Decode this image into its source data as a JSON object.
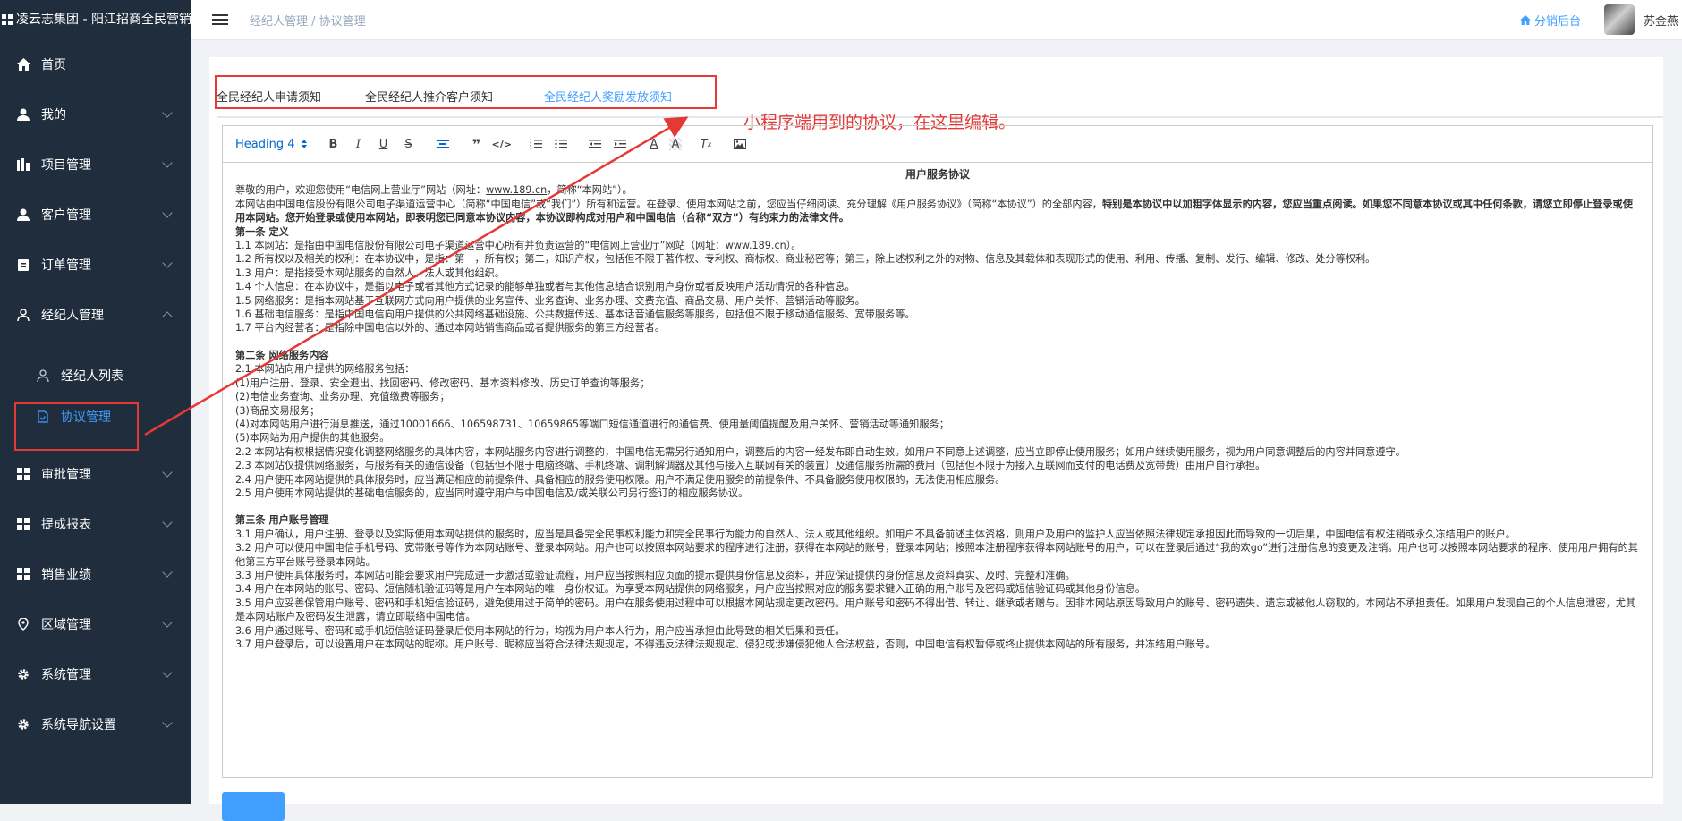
{
  "brand": {
    "title": "凌云志集团 - 阳江招商全民营销"
  },
  "sidebar": {
    "items": [
      {
        "label": "首页",
        "icon": "home-icon",
        "has_children": false
      },
      {
        "label": "我的",
        "icon": "user-icon",
        "has_children": true
      },
      {
        "label": "项目管理",
        "icon": "chart-bars-icon",
        "has_children": true
      },
      {
        "label": "客户管理",
        "icon": "user-icon",
        "has_children": true
      },
      {
        "label": "订单管理",
        "icon": "clipboard-icon",
        "has_children": true
      },
      {
        "label": "经纪人管理",
        "icon": "person-outline-icon",
        "has_children": true,
        "expanded": true,
        "children": [
          {
            "label": "经纪人列表",
            "icon": "person-outline-icon"
          },
          {
            "label": "协议管理",
            "icon": "document-icon",
            "active": true
          }
        ]
      },
      {
        "label": "审批管理",
        "icon": "grid-icon",
        "has_children": true
      },
      {
        "label": "提成报表",
        "icon": "grid-icon",
        "has_children": true
      },
      {
        "label": "销售业绩",
        "icon": "grid-icon",
        "has_children": true
      },
      {
        "label": "区域管理",
        "icon": "location-icon",
        "has_children": true
      },
      {
        "label": "系统管理",
        "icon": "gear-icon",
        "has_children": true
      },
      {
        "label": "系统导航设置",
        "icon": "gear-icon",
        "has_children": true
      }
    ]
  },
  "header": {
    "breadcrumb": [
      "经纪人管理",
      "协议管理"
    ],
    "home_link": "分销后台",
    "username": "苏金燕"
  },
  "tabs": [
    {
      "label": "全民经纪人申请须知"
    },
    {
      "label": "全民经纪人推介客户须知"
    },
    {
      "label": "全民经纪人奖励发放须知",
      "active": true
    }
  ],
  "annotation": {
    "text": "小程序端用到的协议，在这里编辑。",
    "color": "#e53935"
  },
  "editor": {
    "heading_select": "Heading 4",
    "toolbar_icons": [
      "bold-icon",
      "italic-icon",
      "underline-icon",
      "strikethrough-icon",
      "align-icon",
      "blockquote-icon",
      "code-icon",
      "ordered-list-icon",
      "bullet-list-icon",
      "outdent-icon",
      "indent-icon",
      "font-color-icon",
      "background-color-icon",
      "clear-format-icon",
      "image-icon"
    ],
    "content": {
      "title": "用户服务协议",
      "p1a": "尊敬的用户，欢迎您使用“电信网上营业厅”网站（网址：",
      "p1_link": "www.189.cn",
      "p1b": "，简称“本网站”）。",
      "p2a": "本网站由中国电信股份有限公司电子渠道运营中心（简称“中国电信”或“我们”）所有和运营。在登录、使用本网站之前，您应当仔细阅读、充分理解《用户服务协议》（简称“本协议”）的全部内容，",
      "p2b": "特别是本协议中以加粗字体显示的内容，您应当重点阅读。如果您不同意本协议或其中任何条款，请您立即停止登录或使用本网站。您开始登录或使用本网站，即表明您已同意本协议内容，本协议即构成对用户和中国电信（合称“双方”）有约束力的法律文件。",
      "s1": "第一条 定义",
      "s1_1a": "1.1 本网站：是指由中国电信股份有限公司电子渠道运营中心所有并负责运营的“电信网上营业厅”网站（网址：",
      "s1_1_link": "www.189.cn",
      "s1_1b": "）。",
      "s1_2": "1.2 所有权以及相关的权利：在本协议中，是指：第一，所有权；第二，知识产权，包括但不限于著作权、专利权、商标权、商业秘密等；第三，除上述权利之外的对物、信息及其载体和表现形式的使用、利用、传播、复制、发行、编辑、修改、处分等权利。",
      "s1_3": "1.3 用户：是指接受本网站服务的自然人、法人或其他组织。",
      "s1_4": "1.4 个人信息：在本协议中，是指以电子或者其他方式记录的能够单独或者与其他信息结合识别用户身份或者反映用户活动情况的各种信息。",
      "s1_5": "1.5 网络服务：是指本网站基于互联网方式向用户提供的业务宣传、业务查询、业务办理、交费充值、商品交易、用户关怀、营销活动等服务。",
      "s1_6": "1.6 基础电信服务：是指中国电信向用户提供的公共网络基础设施、公共数据传送、基本话音通信服务等服务，包括但不限于移动通信服务、宽带服务等。",
      "s1_7": "1.7 平台内经营者：是指除中国电信以外的、通过本网站销售商品或者提供服务的第三方经营者。",
      "s2": "第二条 网络服务内容",
      "s2_1": "2.1 本网站向用户提供的网络服务包括：",
      "s2_1_1": "(1)用户注册、登录、安全退出、找回密码、修改密码、基本资料修改、历史订单查询等服务；",
      "s2_1_2": "(2)电信业务查询、业务办理、充值缴费等服务；",
      "s2_1_3": "(3)商品交易服务；",
      "s2_1_4": "(4)对本网站用户进行消息推送，通过10001666、106598731、10659865等端口短信通道进行的通信费、使用量阈值提醒及用户关怀、营销活动等通知服务；",
      "s2_1_5": "(5)本网站为用户提供的其他服务。",
      "s2_2": "2.2 本网站有权根据情况变化调整网络服务的具体内容，本网站服务内容进行调整的，中国电信无需另行通知用户，调整后的内容一经发布即自动生效。如用户不同意上述调整，应当立即停止使用服务；如用户继续使用服务，视为用户同意调整后的内容并同意遵守。",
      "s2_3": "2.3 本网站仅提供网络服务，与服务有关的通信设备（包括但不限于电脑终端、手机终端、调制解调器及其他与接入互联网有关的装置）及通信服务所需的费用（包括但不限于为接入互联网而支付的电话费及宽带费）由用户自行承担。",
      "s2_4": "2.4 用户使用本网站提供的具体服务时，应当满足相应的前提条件、具备相应的服务使用权限。用户不满足使用服务的前提条件、不具备服务使用权限的，无法使用相应服务。",
      "s2_5": "2.5 用户使用本网站提供的基础电信服务的，应当同时遵守用户与中国电信及/或关联公司另行签订的相应服务协议。",
      "s3": "第三条 用户账号管理",
      "s3_1": "3.1 用户确认，用户注册、登录以及实际使用本网站提供的服务时，应当是具备完全民事权利能力和完全民事行为能力的自然人、法人或其他组织。如用户不具备前述主体资格，则用户及用户的监护人应当依照法律规定承担因此而导致的一切后果，中国电信有权注销或永久冻结用户的账户。",
      "s3_2": "3.2 用户可以使用中国电信手机号码、宽带账号等作为本网站账号、登录本网站。用户也可以按照本网站要求的程序进行注册，获得在本网站的账号，登录本网站；按照本注册程序获得本网站账号的用户，可以在登录后通过“我的欢go”进行注册信息的变更及注销。用户也可以按照本网站要求的程序、使用用户拥有的其他第三方平台账号登录本网站。",
      "s3_3": "3.3 用户使用具体服务时，本网站可能会要求用户完成进一步激活或验证流程，用户应当按照相应页面的提示提供身份信息及资料，并应保证提供的身份信息及资料真实、及时、完整和准确。",
      "s3_4": "3.4 用户在本网站的账号、密码、短信随机验证码等是用户在本网站的唯一身份权证。为享受本网站提供的网络服务，用户应当按照对应的服务要求键入正确的用户账号及密码或短信验证码或其他身份信息。",
      "s3_5": "3.5 用户应妥善保管用户账号、密码和手机短信验证码，避免使用过于简单的密码。用户在服务使用过程中可以根据本网站规定更改密码。用户账号和密码不得出借、转让、继承或者赠与。因非本网站原因导致用户的账号、密码遗失、遗忘或被他人窃取的，本网站不承担责任。如果用户发现自己的个人信息泄密，尤其是本网站账户及密码发生泄露，请立即联络中国电信。",
      "s3_6": "3.6 用户通过账号、密码和或手机短信验证码登录后使用本网站的行为，均视为用户本人行为，用户应当承担由此导致的相关后果和责任。",
      "s3_7": "3.7 用户登录后，可以设置用户在本网站的昵称。用户账号、昵称应当符合法律法规规定，不得违反法律法规规定、侵犯或涉嫌侵犯他人合法权益，否则，中国电信有权暂停或终止提供本网站的所有服务，并冻结用户账号。"
    }
  }
}
